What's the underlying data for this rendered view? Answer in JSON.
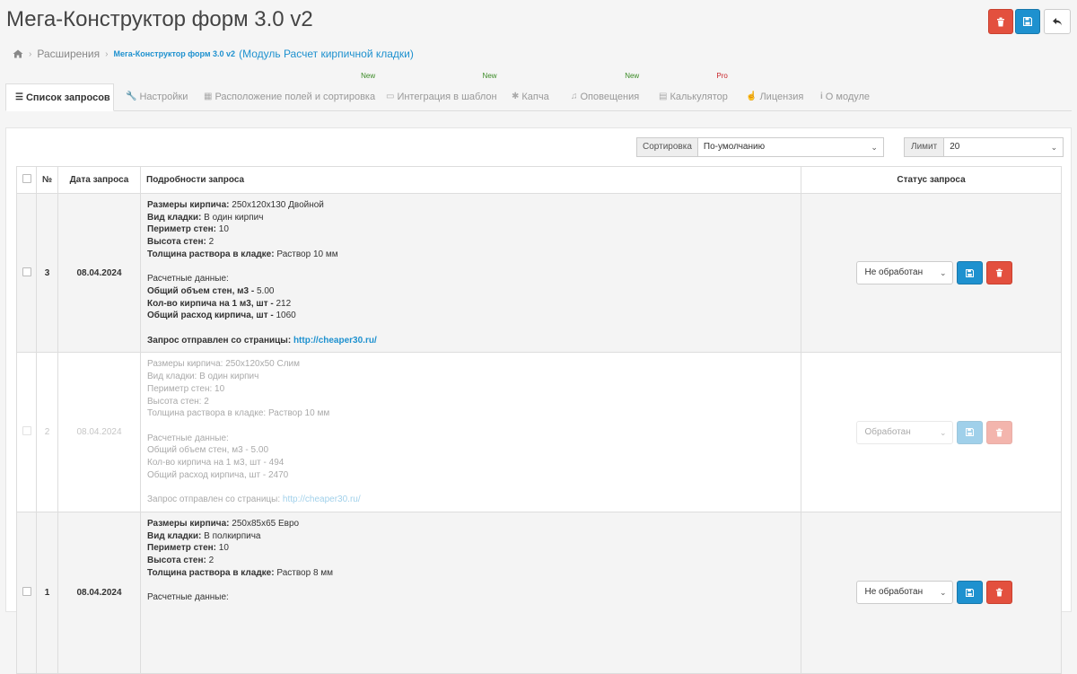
{
  "header": {
    "title": "Мега-Конструктор форм 3.0 v2",
    "buttons": {
      "delete_icon": "trash-icon",
      "save_icon": "save-icon",
      "back_icon": "reply-icon"
    }
  },
  "breadcrumb": {
    "home_icon": "home-icon",
    "extensions": "Расширения",
    "module": "Мега-Конструктор форм 3.0 v2",
    "module_sub": "(Модуль Расчет кирпичной кладки)"
  },
  "tabs": [
    {
      "label": "Список запросов",
      "icon": "list-icon",
      "badge": ""
    },
    {
      "label": "Настройки",
      "icon": "wrench-icon",
      "badge": ""
    },
    {
      "label": "Расположение полей и сортировка",
      "icon": "table-icon",
      "badge": "New"
    },
    {
      "label": "Интеграция в шаблон",
      "icon": "laptop-icon",
      "badge": "New"
    },
    {
      "label": "Капча",
      "icon": "bug-icon",
      "badge": ""
    },
    {
      "label": "Оповещения",
      "icon": "bell-icon",
      "badge": "New"
    },
    {
      "label": "Калькулятор",
      "icon": "calculator-icon",
      "badge": "Pro"
    },
    {
      "label": "Лицензия",
      "icon": "thumbs-up-icon",
      "badge": ""
    },
    {
      "label": "О модуле",
      "icon": "info-icon",
      "badge": ""
    }
  ],
  "filters": {
    "sort_label": "Сортировка",
    "sort_value": "По-умолчанию",
    "limit_label": "Лимит",
    "limit_value": "20"
  },
  "table": {
    "headers": {
      "num": "№",
      "date": "Дата запроса",
      "details": "Подробности запроса",
      "status": "Статус запроса"
    },
    "rows": [
      {
        "num": "3",
        "date": "08.04.2024",
        "brick_label": "Размеры кирпича:",
        "brick": "250х120х130 Двойной",
        "type_label": "Вид кладки:",
        "type": "В один кирпич",
        "perim_label": "Периметр стен:",
        "perim": "10",
        "height_label": "Высота стен:",
        "height": "2",
        "mortar_label": "Толщина раствора в кладке:",
        "mortar": "Раствор 10 мм",
        "calc_label": "Расчетные данные:",
        "vol_label": "Общий объем стен, м3 -",
        "vol": "5.00",
        "per_m3_label": "Кол-во кирпича на 1 м3, шт -",
        "per_m3": "212",
        "total_label": "Общий расход кирпича, шт -",
        "total": "1060",
        "source_label": "Запрос отправлен со страницы:",
        "source": "http://cheaper30.ru/",
        "status": "Не обработан"
      },
      {
        "num": "2",
        "date": "08.04.2024",
        "brick_label": "Размеры кирпича:",
        "brick": "250х120х50 Слим",
        "type_label": "Вид кладки:",
        "type": "В один кирпич",
        "perim_label": "Периметр стен:",
        "perim": "10",
        "height_label": "Высота стен:",
        "height": "2",
        "mortar_label": "Толщина раствора в кладке:",
        "mortar": "Раствор 10 мм",
        "calc_label": "Расчетные данные:",
        "vol_label": "Общий объем стен, м3 -",
        "vol": "5.00",
        "per_m3_label": "Кол-во кирпича на 1 м3, шт -",
        "per_m3": "494",
        "total_label": "Общий расход кирпича, шт -",
        "total": "2470",
        "source_label": "Запрос отправлен со страницы:",
        "source": "http://cheaper30.ru/",
        "status": "Обработан"
      },
      {
        "num": "1",
        "date": "08.04.2024",
        "brick_label": "Размеры кирпича:",
        "brick": "250х85х65 Евро",
        "type_label": "Вид кладки:",
        "type": "В полкирпича",
        "perim_label": "Периметр стен:",
        "perim": "10",
        "height_label": "Высота стен:",
        "height": "2",
        "mortar_label": "Толщина раствора в кладке:",
        "mortar": "Раствор 8 мм",
        "calc_label": "Расчетные данные:",
        "status": "Не обработан"
      }
    ]
  },
  "colors": {
    "primary": "#1e91cf",
    "danger": "#e3503e",
    "new_badge": "#3a8a25",
    "pro_badge": "#c8242a"
  }
}
